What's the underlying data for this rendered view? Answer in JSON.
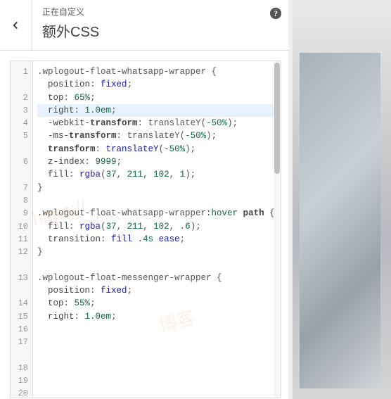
{
  "header": {
    "subtitle": "正在自定义",
    "title": "额外CSS"
  },
  "code_lines": [
    {
      "num": 1,
      "wrap": true,
      "hl": false,
      "tokens": [
        {
          "t": ".wplogout-float-whatsapp-wrapper",
          "c": "tok-selector"
        },
        {
          "t": " {",
          "c": "tok-punct"
        }
      ]
    },
    {
      "num": 2,
      "wrap": false,
      "hl": false,
      "tokens": [
        {
          "t": "  ",
          "c": ""
        },
        {
          "t": "position",
          "c": "tok-prop"
        },
        {
          "t": ": ",
          "c": "tok-punct"
        },
        {
          "t": "fixed",
          "c": "tok-value"
        },
        {
          "t": ";",
          "c": "tok-punct"
        }
      ]
    },
    {
      "num": 3,
      "wrap": false,
      "hl": false,
      "tokens": [
        {
          "t": "  ",
          "c": ""
        },
        {
          "t": "top",
          "c": "tok-prop"
        },
        {
          "t": ": ",
          "c": "tok-punct"
        },
        {
          "t": "65%",
          "c": "tok-number"
        },
        {
          "t": ";",
          "c": "tok-punct"
        }
      ]
    },
    {
      "num": 4,
      "wrap": false,
      "hl": true,
      "tokens": [
        {
          "t": "  ",
          "c": ""
        },
        {
          "t": "right",
          "c": "tok-prop"
        },
        {
          "t": ": ",
          "c": "tok-punct"
        },
        {
          "t": "1.0em",
          "c": "tok-number"
        },
        {
          "t": ";",
          "c": "tok-punct"
        }
      ]
    },
    {
      "num": 5,
      "wrap": true,
      "hl": false,
      "tokens": [
        {
          "t": "  ",
          "c": ""
        },
        {
          "t": "-webkit-",
          "c": "tok-prop"
        },
        {
          "t": "transform",
          "c": "tok-keyword"
        },
        {
          "t": ": ",
          "c": "tok-punct"
        },
        {
          "t": "translateY",
          "c": "tok-selector"
        },
        {
          "t": "(",
          "c": "tok-punct"
        },
        {
          "t": "-50%",
          "c": "tok-number"
        },
        {
          "t": ");",
          "c": "tok-punct"
        }
      ]
    },
    {
      "num": 6,
      "wrap": true,
      "hl": false,
      "tokens": [
        {
          "t": "  ",
          "c": ""
        },
        {
          "t": "-ms-",
          "c": "tok-prop"
        },
        {
          "t": "transform",
          "c": "tok-keyword"
        },
        {
          "t": ": ",
          "c": "tok-punct"
        },
        {
          "t": "translateY",
          "c": "tok-selector"
        },
        {
          "t": "(",
          "c": "tok-punct"
        },
        {
          "t": "-50%",
          "c": "tok-number"
        },
        {
          "t": ");",
          "c": "tok-punct"
        }
      ]
    },
    {
      "num": 7,
      "wrap": false,
      "hl": false,
      "tokens": [
        {
          "t": "  ",
          "c": ""
        },
        {
          "t": "transform",
          "c": "tok-keyword"
        },
        {
          "t": ": ",
          "c": "tok-punct"
        },
        {
          "t": "translateY",
          "c": "tok-value"
        },
        {
          "t": "(",
          "c": "tok-punct"
        },
        {
          "t": "-50%",
          "c": "tok-number"
        },
        {
          "t": ");",
          "c": "tok-punct"
        }
      ]
    },
    {
      "num": 8,
      "wrap": false,
      "hl": false,
      "tokens": [
        {
          "t": "  ",
          "c": ""
        },
        {
          "t": "z-index",
          "c": "tok-prop"
        },
        {
          "t": ": ",
          "c": "tok-punct"
        },
        {
          "t": "9999",
          "c": "tok-number"
        },
        {
          "t": ";",
          "c": "tok-punct"
        }
      ]
    },
    {
      "num": 9,
      "wrap": false,
      "hl": false,
      "tokens": [
        {
          "t": "  ",
          "c": ""
        },
        {
          "t": "fill",
          "c": "tok-prop"
        },
        {
          "t": ": ",
          "c": "tok-punct"
        },
        {
          "t": "rgba",
          "c": "tok-value"
        },
        {
          "t": "(",
          "c": "tok-punct"
        },
        {
          "t": "37",
          "c": "tok-number"
        },
        {
          "t": ", ",
          "c": "tok-punct"
        },
        {
          "t": "211",
          "c": "tok-number"
        },
        {
          "t": ", ",
          "c": "tok-punct"
        },
        {
          "t": "102",
          "c": "tok-number"
        },
        {
          "t": ", ",
          "c": "tok-punct"
        },
        {
          "t": "1",
          "c": "tok-number"
        },
        {
          "t": ");",
          "c": "tok-punct"
        }
      ]
    },
    {
      "num": 10,
      "wrap": false,
      "hl": false,
      "tokens": [
        {
          "t": "}",
          "c": "tok-punct"
        }
      ]
    },
    {
      "num": 11,
      "wrap": false,
      "hl": false,
      "tokens": []
    },
    {
      "num": 12,
      "wrap": true,
      "hl": false,
      "tokens": [
        {
          "t": ".wplogout-float-whatsapp-wrapper",
          "c": "tok-selector"
        },
        {
          "t": ":hover",
          "c": "tok-number"
        },
        {
          "t": " ",
          "c": ""
        },
        {
          "t": "path",
          "c": "tok-keyword"
        },
        {
          "t": " {",
          "c": "tok-punct"
        }
      ]
    },
    {
      "num": 13,
      "wrap": true,
      "hl": false,
      "tokens": [
        {
          "t": "  ",
          "c": ""
        },
        {
          "t": "fill",
          "c": "tok-prop"
        },
        {
          "t": ": ",
          "c": "tok-punct"
        },
        {
          "t": "rgba",
          "c": "tok-value"
        },
        {
          "t": "(",
          "c": "tok-punct"
        },
        {
          "t": "37",
          "c": "tok-number"
        },
        {
          "t": ", ",
          "c": "tok-punct"
        },
        {
          "t": "211",
          "c": "tok-number"
        },
        {
          "t": ", ",
          "c": "tok-punct"
        },
        {
          "t": "102",
          "c": "tok-number"
        },
        {
          "t": ", ",
          "c": "tok-punct"
        },
        {
          "t": ".6",
          "c": "tok-number"
        },
        {
          "t": ");",
          "c": "tok-punct"
        }
      ]
    },
    {
      "num": 14,
      "wrap": false,
      "hl": false,
      "tokens": [
        {
          "t": "  ",
          "c": ""
        },
        {
          "t": "transition",
          "c": "tok-prop"
        },
        {
          "t": ": ",
          "c": "tok-punct"
        },
        {
          "t": "fill",
          "c": "tok-value"
        },
        {
          "t": " ",
          "c": ""
        },
        {
          "t": ".4s",
          "c": "tok-number"
        },
        {
          "t": " ",
          "c": ""
        },
        {
          "t": "ease",
          "c": "tok-value"
        },
        {
          "t": ";",
          "c": "tok-punct"
        }
      ]
    },
    {
      "num": 15,
      "wrap": false,
      "hl": false,
      "tokens": [
        {
          "t": "}",
          "c": "tok-punct"
        }
      ]
    },
    {
      "num": 16,
      "wrap": false,
      "hl": false,
      "tokens": []
    },
    {
      "num": 17,
      "wrap": true,
      "hl": false,
      "tokens": [
        {
          "t": ".wplogout-float-messenger-wrapper",
          "c": "tok-selector"
        },
        {
          "t": " {",
          "c": "tok-punct"
        }
      ]
    },
    {
      "num": 18,
      "wrap": false,
      "hl": false,
      "tokens": [
        {
          "t": "  ",
          "c": ""
        },
        {
          "t": "position",
          "c": "tok-prop"
        },
        {
          "t": ": ",
          "c": "tok-punct"
        },
        {
          "t": "fixed",
          "c": "tok-value"
        },
        {
          "t": ";",
          "c": "tok-punct"
        }
      ]
    },
    {
      "num": 19,
      "wrap": false,
      "hl": false,
      "tokens": [
        {
          "t": "  ",
          "c": ""
        },
        {
          "t": "top",
          "c": "tok-prop"
        },
        {
          "t": ": ",
          "c": "tok-punct"
        },
        {
          "t": "55%",
          "c": "tok-number"
        },
        {
          "t": ";",
          "c": "tok-punct"
        }
      ]
    },
    {
      "num": 20,
      "wrap": false,
      "hl": false,
      "tokens": [
        {
          "t": "  ",
          "c": ""
        },
        {
          "t": "right",
          "c": "tok-prop"
        },
        {
          "t": ": ",
          "c": "tok-punct"
        },
        {
          "t": "1.0em",
          "c": "tok-number"
        },
        {
          "t": ";",
          "c": "tok-punct"
        }
      ]
    }
  ],
  "watermarks": {
    "wm1": "https://",
    "wm2": "博客"
  }
}
